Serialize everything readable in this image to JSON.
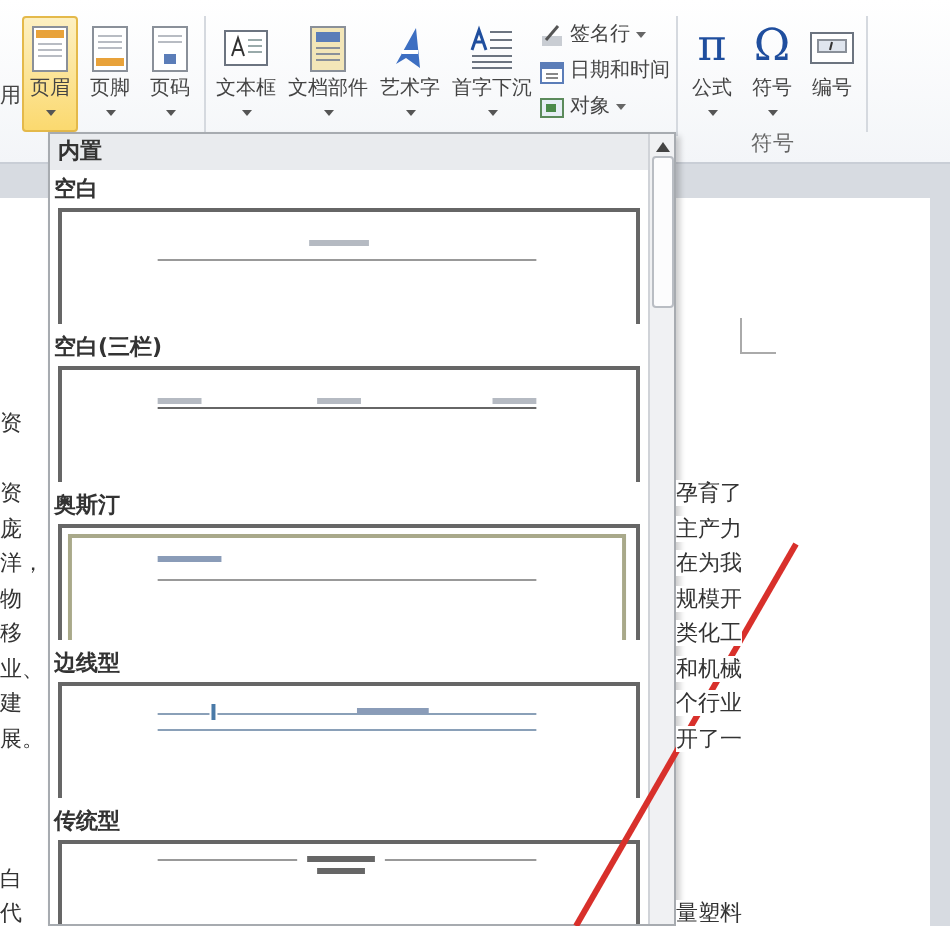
{
  "ribbon": {
    "cut_label": "用",
    "groups": [
      {
        "buttons": [
          {
            "label": "页眉",
            "kind": "header",
            "dropdown": true,
            "selected": true
          },
          {
            "label": "页脚",
            "kind": "footer",
            "dropdown": true,
            "selected": false
          },
          {
            "label": "页码",
            "kind": "pagenum",
            "dropdown": true,
            "selected": false
          }
        ]
      },
      {
        "buttons": [
          {
            "label": "文本框",
            "kind": "textbox",
            "dropdown": true,
            "selected": false
          },
          {
            "label": "文档部件",
            "kind": "parts",
            "dropdown": true,
            "selected": false
          },
          {
            "label": "艺术字",
            "kind": "wordart",
            "dropdown": true,
            "selected": false
          },
          {
            "label": "首字下沉",
            "kind": "dropcap",
            "dropdown": true,
            "selected": false
          }
        ],
        "small_commands": [
          {
            "label": "签名行",
            "kind": "signature",
            "dropdown": true
          },
          {
            "label": "日期和时间",
            "kind": "calendar",
            "dropdown": false
          },
          {
            "label": "对象",
            "kind": "object",
            "dropdown": true
          }
        ]
      },
      {
        "buttons": [
          {
            "label": "公式",
            "kind": "glyph",
            "glyph": "π",
            "dropdown": true,
            "selected": false
          },
          {
            "label": "符号",
            "kind": "glyph",
            "glyph": "Ω",
            "dropdown": true,
            "selected": false
          },
          {
            "label": "编号",
            "kind": "numbering",
            "dropdown": false,
            "selected": false
          }
        ],
        "label": "符号"
      }
    ]
  },
  "gallery": {
    "section": "内置",
    "items": [
      {
        "label": "空白",
        "kind": "blank"
      },
      {
        "label": "空白(三栏)",
        "kind": "three"
      },
      {
        "label": "奥斯汀",
        "kind": "austin"
      },
      {
        "label": "边线型",
        "kind": "sideline"
      },
      {
        "label": "传统型",
        "kind": "traditional"
      }
    ]
  },
  "document": {
    "lines": [
      {
        "kind": "text",
        "left": "资"
      },
      {
        "kind": "blank"
      },
      {
        "kind": "text",
        "left": "资",
        "right": "孕育了"
      },
      {
        "kind": "text",
        "left": "庞",
        "right": "主产力"
      },
      {
        "kind": "text",
        "left": "洋，",
        "right": "在为我"
      },
      {
        "kind": "text",
        "left": "物",
        "right": "规模开"
      },
      {
        "kind": "text",
        "left": "移",
        "right": "类化工"
      },
      {
        "kind": "text",
        "left": "业、",
        "right": "和机械"
      },
      {
        "kind": "text",
        "left": "建",
        "right": "个行业"
      },
      {
        "kind": "text",
        "left": "展。",
        "right": "开了一"
      },
      {
        "kind": "blank"
      },
      {
        "kind": "blank"
      },
      {
        "kind": "blank"
      },
      {
        "kind": "text",
        "left": "白"
      },
      {
        "kind": "text",
        "left": "代",
        "right": "量塑料"
      }
    ]
  }
}
